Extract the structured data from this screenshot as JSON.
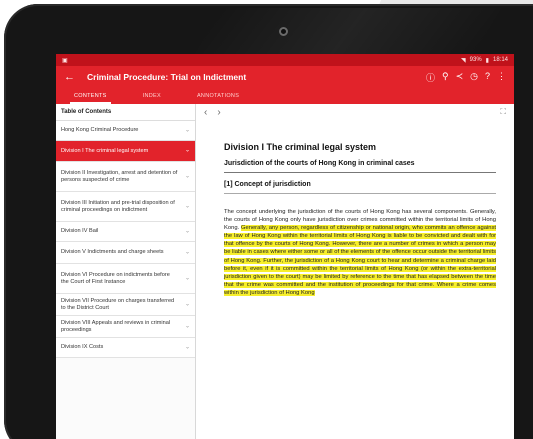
{
  "status_bar": {
    "left_icon": "image-icon",
    "right_text": "93%",
    "time": "18:14"
  },
  "app_bar": {
    "title": "Criminal Procedure: Trial on Indictment",
    "actions": [
      "info-icon",
      "search-icon",
      "share-icon",
      "history-icon",
      "help-icon",
      "more-icon"
    ]
  },
  "tabs": [
    "CONTENTS",
    "INDEX",
    "ANNOTATIONS"
  ],
  "toc": {
    "header": "Table of Contents",
    "items": [
      "Hong Kong Criminal Procedure",
      "Division I The criminal legal system",
      "Division II Investigation, arrest and detention of persons suspected of crime",
      "Division III Initiation and pre-trial disposition of criminal proceedings on indictment",
      "Division IV Bail",
      "Division V Indictments and charge sheets",
      "Division VI Procedure on indictments before the Court of First Instance",
      "Division VII Procedure on charges transferred to the District Court",
      "Division VIII Appeals and reviews in criminal proceedings",
      "Division IX Costs"
    ]
  },
  "document": {
    "heading": "Division I The criminal legal system",
    "subheading": "Jurisdiction of the courts of Hong Kong in criminal cases",
    "section": "[1] Concept of jurisdiction",
    "para_plain": "The concept underlying the jurisdiction of the courts of Hong Kong has several components. Generally, the courts of Hong Kong only have jurisdiction over crimes committed within the territorial limits of Hong Kong. ",
    "para_highlight": "Generally, any person, regardless of citizenship or national origin, who commits an offence against the law of Hong Kong within the territorial limits of Hong Kong is liable to be convicted and dealt with for that offence by the courts of Hong Kong. However, there are a number of crimes in which a person may be liable in cases where either some or all of the elements of the offence occur outside the territorial limits of Hong Kong. Further, the jurisdiction of a Hong Kong court to hear and determine a criminal charge laid before it, even if it is committed within the territorial limits of Hong Kong (or within the extra-territorial jurisdiction given to the court) may be limited by reference to the time that has elapsed between the time that the crime was committed and the institution of proceedings for that crime. Where a crime comes within the jurisdiction of Hong Kong"
  }
}
